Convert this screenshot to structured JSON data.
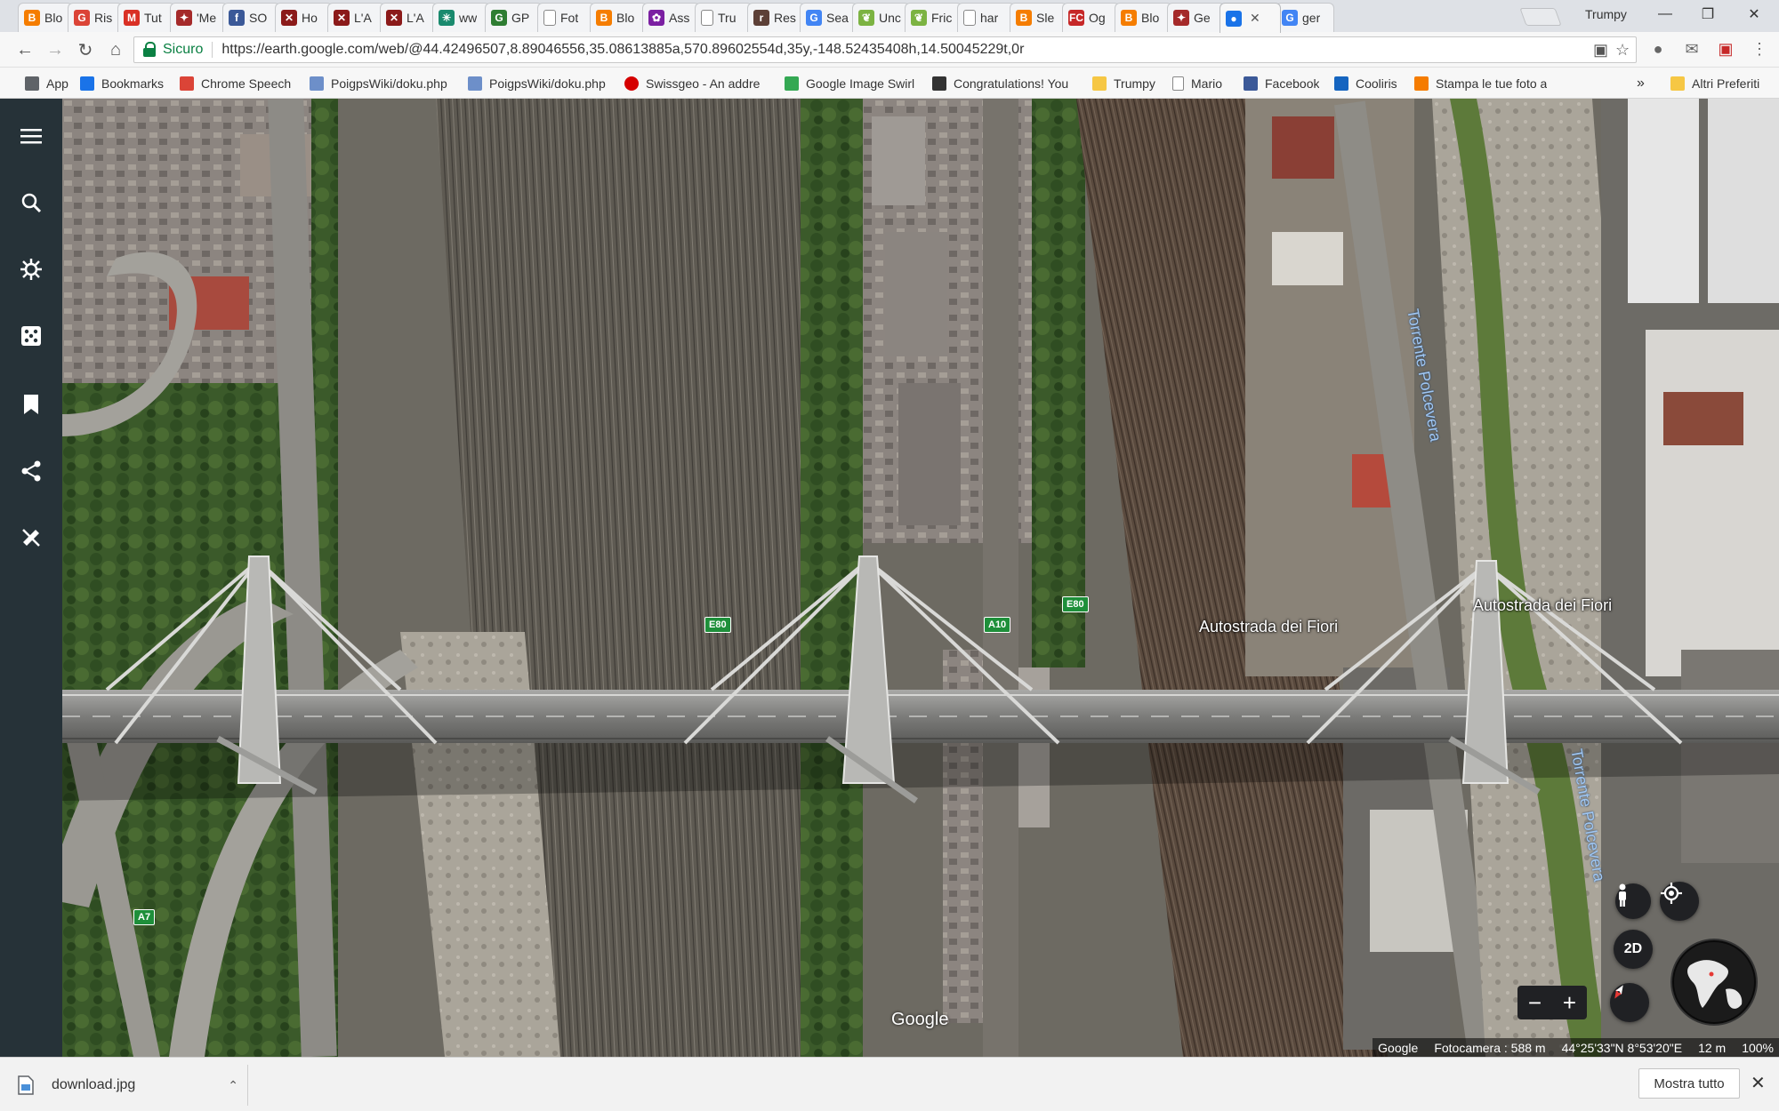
{
  "browser": {
    "tabs": [
      {
        "title": "Blo",
        "icon": "blogger-icon",
        "color": "#f57d00",
        "glyph": "B"
      },
      {
        "title": "Ris",
        "icon": "google-plus-icon",
        "color": "#db4437",
        "glyph": "G"
      },
      {
        "title": "Tut",
        "icon": "gmail-icon",
        "color": "#d93025",
        "glyph": "M"
      },
      {
        "title": "'Me",
        "icon": "bird-icon",
        "color": "#a52a2a",
        "glyph": "✦"
      },
      {
        "title": "SO",
        "icon": "facebook-icon",
        "color": "#3b5998",
        "glyph": "f"
      },
      {
        "title": "Ho",
        "icon": "wiki-icon",
        "color": "#8b1a1a",
        "glyph": "✕"
      },
      {
        "title": "L'A",
        "icon": "wiki-icon",
        "color": "#8b1a1a",
        "glyph": "✕"
      },
      {
        "title": "L'A",
        "icon": "wiki-icon",
        "color": "#8b1a1a",
        "glyph": "✕"
      },
      {
        "title": "ww",
        "icon": "asterisk-icon",
        "color": "#1a8a6e",
        "glyph": "✳"
      },
      {
        "title": "GP",
        "icon": "g-icon",
        "color": "#2e7d32",
        "glyph": "G"
      },
      {
        "title": "Fot",
        "icon": "page-icon",
        "color": "#9e9e9e",
        "glyph": ""
      },
      {
        "title": "Blo",
        "icon": "blogger-icon",
        "color": "#f57d00",
        "glyph": "B"
      },
      {
        "title": "Ass",
        "icon": "puzzle-icon",
        "color": "#7b1fa2",
        "glyph": "✿"
      },
      {
        "title": "Tru",
        "icon": "page-icon",
        "color": "#9e9e9e",
        "glyph": ""
      },
      {
        "title": "Res",
        "icon": "r-icon",
        "color": "#5d4037",
        "glyph": "r"
      },
      {
        "title": "Sea",
        "icon": "google-icon",
        "color": "#4285f4",
        "glyph": "G"
      },
      {
        "title": "Unc",
        "icon": "leaf-icon",
        "color": "#7cb342",
        "glyph": "❦"
      },
      {
        "title": "Fric",
        "icon": "leaf-icon",
        "color": "#7cb342",
        "glyph": "❦"
      },
      {
        "title": "har",
        "icon": "page-icon",
        "color": "#9e9e9e",
        "glyph": ""
      },
      {
        "title": "Sle",
        "icon": "blogger-icon",
        "color": "#f57d00",
        "glyph": "B"
      },
      {
        "title": "Og",
        "icon": "fc-icon",
        "color": "#c62828",
        "glyph": "FC"
      },
      {
        "title": "Blo",
        "icon": "blogger-icon",
        "color": "#f57d00",
        "glyph": "B"
      },
      {
        "title": "Ge",
        "icon": "bird-icon",
        "color": "#a52a2a",
        "glyph": "✦"
      },
      {
        "title": "",
        "icon": "google-earth-icon",
        "color": "#1a73e8",
        "glyph": "●",
        "active": true
      },
      {
        "title": "ger",
        "icon": "google-icon",
        "color": "#4285f4",
        "glyph": "G"
      }
    ],
    "profile": "Trumpy",
    "secure_label": "Sicuro",
    "url": "https://earth.google.com/web/@44.42496507,8.89046556,35.08613885a,570.89602554d,35y,-148.52435408h,14.50045229t,0r",
    "bookmarks": [
      {
        "label": "App",
        "icon": "apps-grid-icon",
        "color": "#5f6368"
      },
      {
        "label": "Bookmarks",
        "icon": "star-icon",
        "color": "#1a73e8"
      },
      {
        "label": "Chrome Speech",
        "icon": "chrome-icon",
        "color": "#db4437"
      },
      {
        "label": "PoigpsWiki/doku.php",
        "icon": "wiki-doc-icon",
        "color": "#6d8fc9"
      },
      {
        "label": "PoigpsWiki/doku.php",
        "icon": "wiki-doc-icon",
        "color": "#6d8fc9"
      },
      {
        "label": "Swissgeo - An addre",
        "icon": "red-circle-icon",
        "color": "#d50000"
      },
      {
        "label": "Google Image Swirl",
        "icon": "swirl-icon",
        "color": "#34a853"
      },
      {
        "label": "Congratulations! You",
        "icon": "x-icon",
        "color": "#333333"
      },
      {
        "label": "Trumpy",
        "icon": "folder-icon",
        "color": "#f6c744"
      },
      {
        "label": "Mario",
        "icon": "page-icon",
        "color": "#9e9e9e"
      },
      {
        "label": "Facebook",
        "icon": "facebook-icon",
        "color": "#3b5998"
      },
      {
        "label": "Cooliris",
        "icon": "cooliris-icon",
        "color": "#1565c0"
      },
      {
        "label": "Stampa le tue foto a",
        "icon": "photo-icon",
        "color": "#f57c00"
      }
    ],
    "bookmarks_overflow": "»",
    "other_bookmarks": "Altri Preferiti"
  },
  "map": {
    "road_labels": [
      "Autostrada dei Fiori",
      "Autostrada dei Fiori"
    ],
    "river_labels": [
      "Torrente Polcevera",
      "Torrente Polcevera"
    ],
    "shields": [
      "E80",
      "A10",
      "E80",
      "A7"
    ],
    "watermark": "Google",
    "view_mode": "2D",
    "status": {
      "provider": "Google",
      "camera": "Fotocamera : 588 m",
      "coords": "44°25'33\"N 8°53'20\"E",
      "elevation": "12 m",
      "zoom": "100%"
    }
  },
  "download": {
    "filename": "download.jpg",
    "show_all": "Mostra tutto"
  }
}
